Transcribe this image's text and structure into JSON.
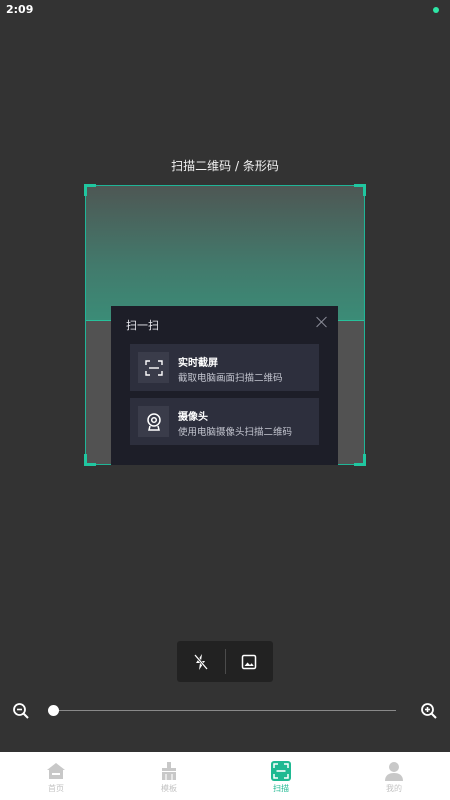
{
  "status": {
    "time": "2:09"
  },
  "scan": {
    "title": "扫描二维码 / 条形码"
  },
  "dialog": {
    "title": "扫一扫",
    "options": [
      {
        "title": "实时截屏",
        "desc": "截取电脑画面扫描二维码",
        "icon": "screen-scan-icon"
      },
      {
        "title": "摄像头",
        "desc": "使用电脑摄像头扫描二维码",
        "icon": "webcam-icon"
      }
    ]
  },
  "zoom": {
    "level": 0
  },
  "tabs": [
    {
      "label": "首页",
      "icon": "home-icon",
      "active": false
    },
    {
      "label": "模板",
      "icon": "template-icon",
      "active": false
    },
    {
      "label": "扫描",
      "icon": "scan-icon",
      "active": true
    },
    {
      "label": "我的",
      "icon": "profile-icon",
      "active": false
    }
  ],
  "colors": {
    "accent": "#1fb992",
    "background": "#333333",
    "dialog": "#1d1e28"
  }
}
